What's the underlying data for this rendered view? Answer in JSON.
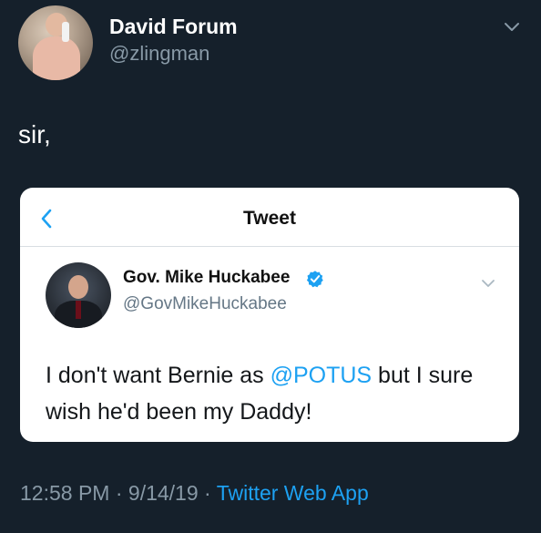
{
  "author": {
    "name": "David Forum",
    "handle": "@zlingman"
  },
  "tweet": {
    "text": "sir,"
  },
  "quoted_screenshot": {
    "header_title": "Tweet",
    "author_name": "Gov. Mike Huckabee",
    "author_handle": "@GovMikeHuckabee",
    "text_before": "I don't want Bernie as ",
    "mention": "@POTUS",
    "text_after": " but I sure wish he'd been my Daddy!"
  },
  "meta": {
    "time": "12:58 PM",
    "separator1": " · ",
    "date": "9/14/19",
    "separator2": " · ",
    "app": "Twitter Web App"
  },
  "colors": {
    "background": "#15202b",
    "accent": "#1da1f2",
    "secondary_text": "#8899a6"
  },
  "icons": {
    "top_right": "chevron-down-icon",
    "back": "chevron-left-icon",
    "verified": "verified-badge-icon",
    "inner_menu": "chevron-down-icon"
  }
}
